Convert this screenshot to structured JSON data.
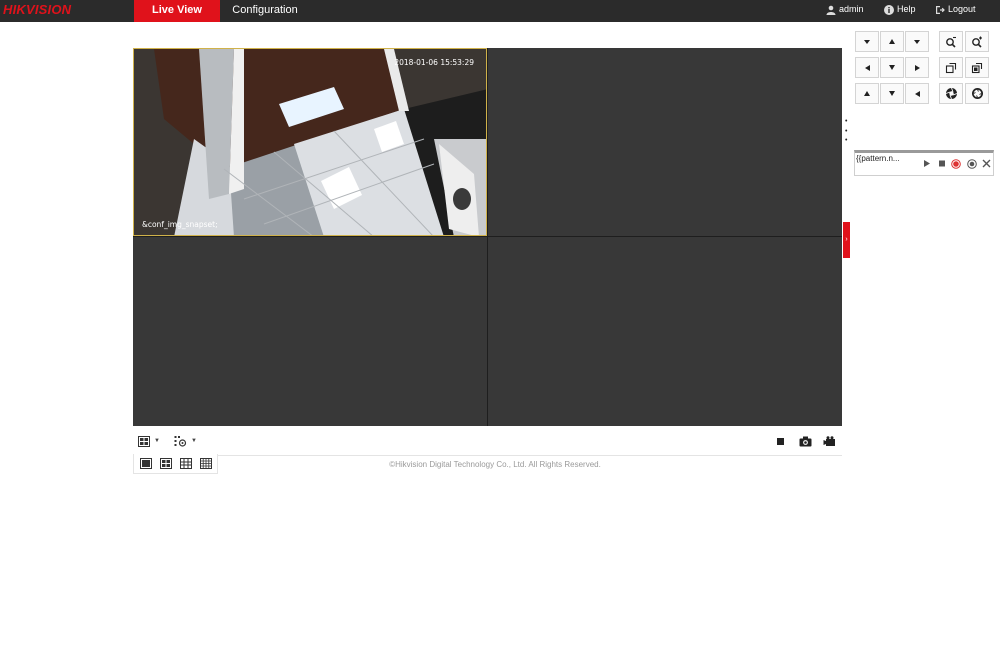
{
  "header": {
    "logo": "HIKVISION",
    "tabs": [
      {
        "label": "Live View",
        "active": true
      },
      {
        "label": "Configuration",
        "active": false
      }
    ],
    "user": "admin",
    "help": "Help",
    "logout": "Logout"
  },
  "video": {
    "timestamp": "2018-01-06 15:53:29",
    "osd_name": "&conf_img_snapset;"
  },
  "pattern": {
    "name": "{{pattern.n..."
  },
  "footer": {
    "copyright": "©Hikvision Digital Technology Co., Ltd. All Rights Reserved."
  },
  "colors": {
    "brand_red": "#e0121b",
    "topbar": "#2b2b2b",
    "tile": "#383838",
    "selected_border": "#d0b24a"
  },
  "icons": {
    "ptz": [
      "up-left-arrow-icon",
      "up-arrow-icon",
      "up-right-arrow-icon",
      "left-arrow-icon",
      "auto-pan-icon",
      "right-arrow-icon",
      "down-left-arrow-icon",
      "down-arrow-icon",
      "down-right-arrow-icon"
    ],
    "lens": [
      "zoom-out-icon",
      "zoom-in-icon",
      "focus-near-icon",
      "focus-far-icon",
      "iris-close-icon",
      "iris-open-icon"
    ]
  }
}
